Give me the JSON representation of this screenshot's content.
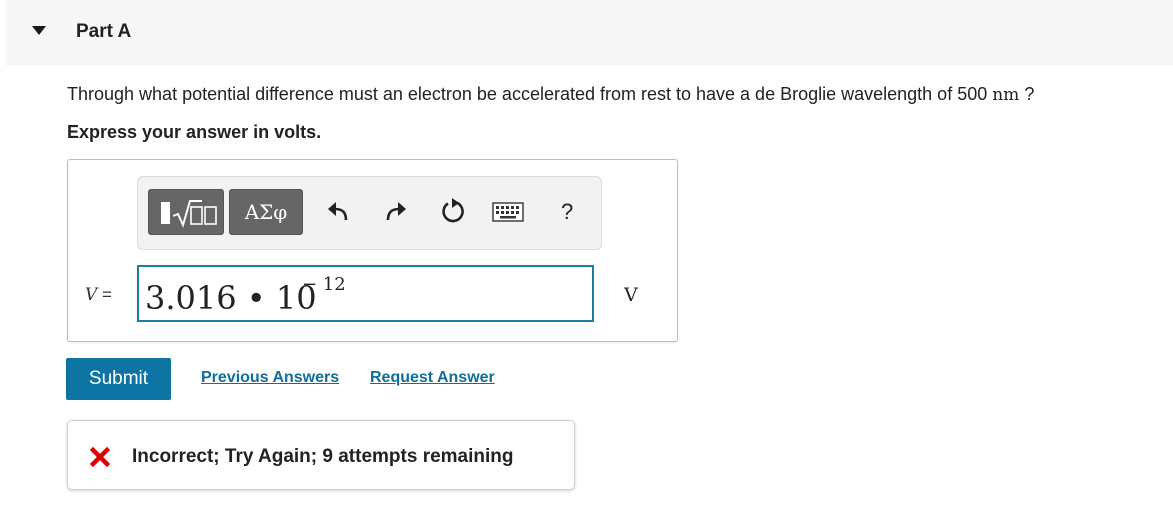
{
  "part": {
    "title": "Part A"
  },
  "question": {
    "text_before": "Through what potential difference must an electron be accelerated from rest to have a de Broglie wavelength of 500 ",
    "unit": "nm",
    "text_after": " ?"
  },
  "instruction": "Express your answer in volts.",
  "toolbar": {
    "greek_label": "ΑΣφ",
    "help_label": "?"
  },
  "answer": {
    "variable": "V",
    "equals": "=",
    "mantissa": "3.016 • 10",
    "exponent": "− 12",
    "unit": "V"
  },
  "actions": {
    "submit": "Submit",
    "previous_answers": "Previous Answers",
    "request_answer": "Request Answer"
  },
  "feedback": {
    "text": "Incorrect; Try Again; 9 attempts remaining",
    "icon_color": "#e00000"
  },
  "colors": {
    "accent": "#0d73a3",
    "link": "#0f6e9a",
    "input_border": "#1b7da0"
  }
}
